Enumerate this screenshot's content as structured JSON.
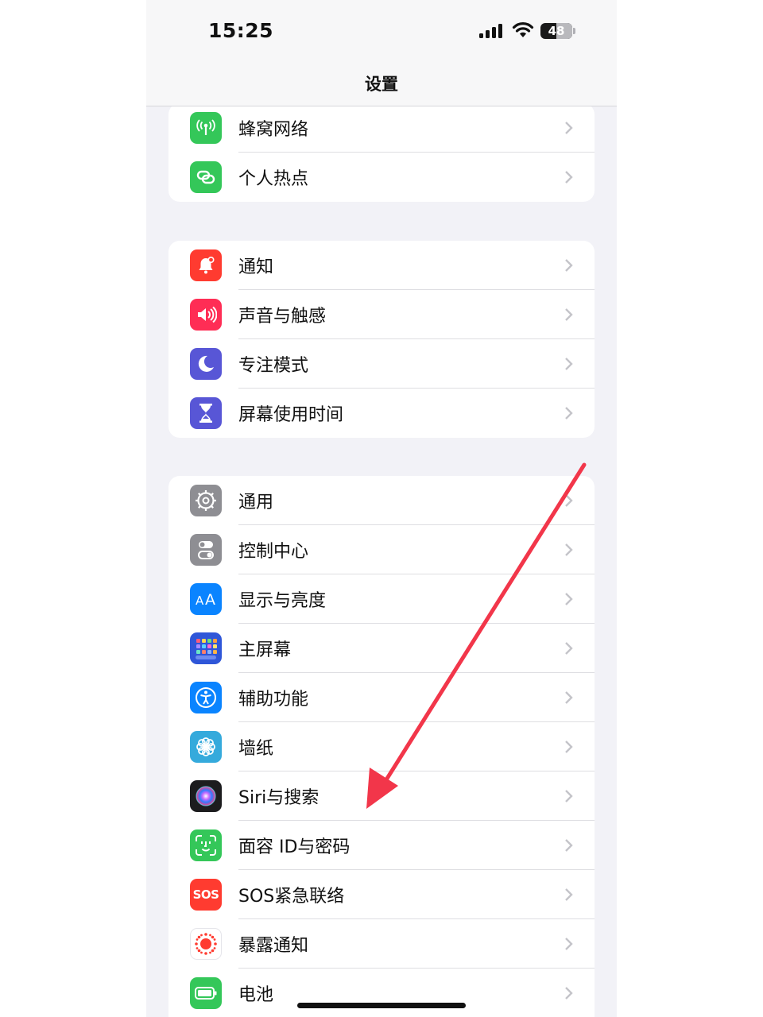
{
  "status_bar": {
    "time": "15:25",
    "battery": "48"
  },
  "nav": {
    "title": "设置"
  },
  "groups": [
    {
      "items": [
        {
          "label": "蜂窝网络",
          "icon": "antenna-icon",
          "color": "#34c759"
        },
        {
          "label": "个人热点",
          "icon": "hotspot-link-icon",
          "color": "#34c759"
        }
      ]
    },
    {
      "items": [
        {
          "label": "通知",
          "icon": "bell-icon",
          "color": "#ff3b30"
        },
        {
          "label": "声音与触感",
          "icon": "speaker-icon",
          "color": "#ff2d55"
        },
        {
          "label": "专注模式",
          "icon": "moon-icon",
          "color": "#5856d6"
        },
        {
          "label": "屏幕使用时间",
          "icon": "hourglass-icon",
          "color": "#5856d6"
        }
      ]
    },
    {
      "items": [
        {
          "label": "通用",
          "icon": "gear-icon",
          "color": "#8e8e93"
        },
        {
          "label": "控制中心",
          "icon": "toggles-icon",
          "color": "#8e8e93"
        },
        {
          "label": "显示与亮度",
          "icon": "text-size-icon",
          "color": "#0a84ff"
        },
        {
          "label": "主屏幕",
          "icon": "app-grid-icon",
          "color": "#2f56d8"
        },
        {
          "label": "辅助功能",
          "icon": "accessibility-icon",
          "color": "#0a84ff"
        },
        {
          "label": "墙纸",
          "icon": "flower-icon",
          "color": "#35aadc"
        },
        {
          "label": "Siri与搜索",
          "icon": "siri-icon",
          "color": "#1c1c1e"
        },
        {
          "label": "面容 ID与密码",
          "icon": "face-id-icon",
          "color": "#34c759"
        },
        {
          "label": "SOS紧急联络",
          "icon": "sos-icon",
          "color": "#ff3b30",
          "icon_text": "SOS"
        },
        {
          "label": "暴露通知",
          "icon": "exposure-icon",
          "color": "#ffffff"
        },
        {
          "label": "电池",
          "icon": "battery-icon",
          "color": "#34c759"
        }
      ]
    }
  ]
}
